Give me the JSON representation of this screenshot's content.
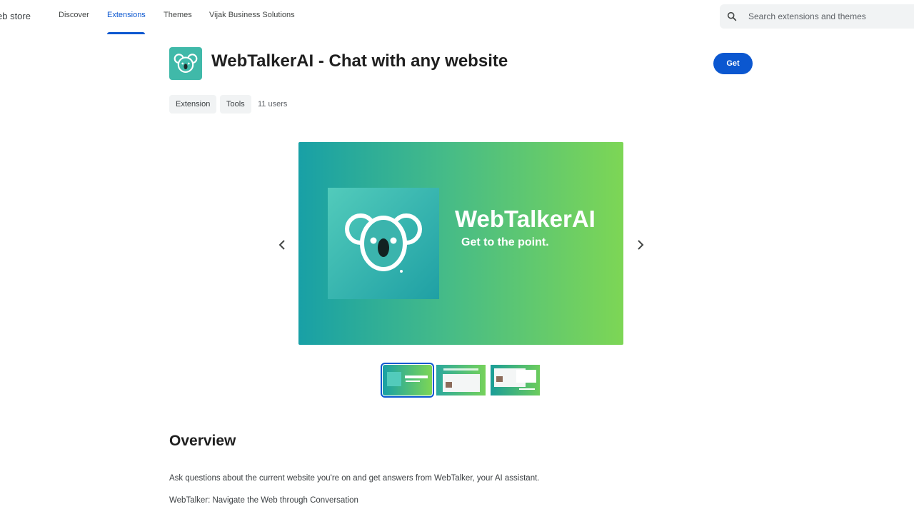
{
  "header": {
    "brand": "eb store",
    "nav": [
      {
        "label": "Discover"
      },
      {
        "label": "Extensions"
      },
      {
        "label": "Themes"
      },
      {
        "label": "Vijak Business Solutions"
      }
    ],
    "search": {
      "placeholder": "Search extensions and themes",
      "icon": "search-icon"
    }
  },
  "app": {
    "title": "WebTalkerAI - Chat with any website",
    "get_label": "Get",
    "chips": [
      "Extension",
      "Tools"
    ],
    "users": "11 users",
    "icon": "koala-icon"
  },
  "carousel": {
    "hero_title": "WebTalkerAI",
    "hero_tagline": "Get to the point.",
    "thumb_count": 3,
    "selected_index": 0,
    "prev_icon": "chevron-left-icon",
    "next_icon": "chevron-right-icon"
  },
  "overview": {
    "heading": "Overview",
    "paragraphs": [
      "Ask questions about the current website you're on and get answers from WebTalker, your AI assistant.",
      "WebTalker: Navigate the Web through Conversation"
    ]
  },
  "colors": {
    "accent": "#0b57d0",
    "icon_teal": "#40b9a9",
    "gradient_start": "#18a0a6",
    "gradient_end": "#7dd655"
  }
}
